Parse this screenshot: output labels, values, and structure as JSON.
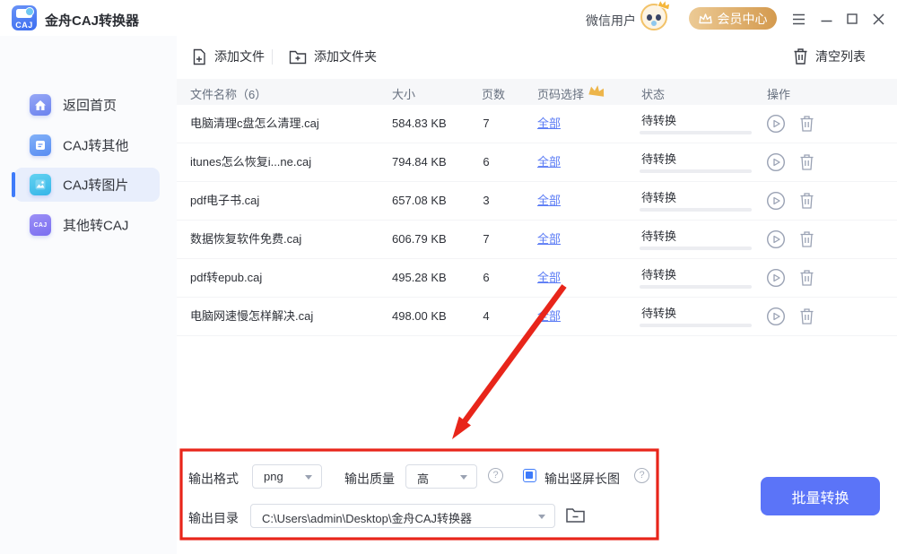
{
  "titlebar": {
    "app_title": "金舟CAJ转换器",
    "logo_text": "CAJ",
    "user_name": "微信用户",
    "member_center": "会员中心"
  },
  "sidebar": {
    "items": [
      {
        "label": "返回首页",
        "icon": "home-icon",
        "active": false
      },
      {
        "label": "CAJ转其他",
        "icon": "document-icon",
        "active": false
      },
      {
        "label": "CAJ转图片",
        "icon": "image-icon",
        "active": true
      },
      {
        "label": "其他转CAJ",
        "icon": "caj-badge-icon",
        "active": false
      }
    ],
    "caj_badge_text": "CAJ"
  },
  "toolbar": {
    "add_file": "添加文件",
    "add_folder": "添加文件夹",
    "clear_list": "清空列表"
  },
  "table": {
    "headers": {
      "name": "文件名称（6）",
      "size": "大小",
      "pages": "页数",
      "page_select": "页码选择",
      "status": "状态",
      "action": "操作"
    },
    "rows": [
      {
        "name": "电脑清理c盘怎么清理.caj",
        "size": "584.83 KB",
        "pages": "7",
        "page_select": "全部",
        "status": "待转换"
      },
      {
        "name": "itunes怎么恢复i...ne.caj",
        "size": "794.84 KB",
        "pages": "6",
        "page_select": "全部",
        "status": "待转换"
      },
      {
        "name": "pdf电子书.caj",
        "size": "657.08 KB",
        "pages": "3",
        "page_select": "全部",
        "status": "待转换"
      },
      {
        "name": "数据恢复软件免费.caj",
        "size": "606.79 KB",
        "pages": "7",
        "page_select": "全部",
        "status": "待转换"
      },
      {
        "name": "pdf转epub.caj",
        "size": "495.28 KB",
        "pages": "6",
        "page_select": "全部",
        "status": "待转换"
      },
      {
        "name": "电脑网速慢怎样解决.caj",
        "size": "498.00 KB",
        "pages": "4",
        "page_select": "全部",
        "status": "待转换"
      }
    ]
  },
  "settings": {
    "output_format_label": "输出格式",
    "output_format_value": "png",
    "output_quality_label": "输出质量",
    "output_quality_value": "高",
    "vertical_long_image_label": "输出竖屏长图",
    "vertical_long_image_checked": true,
    "output_dir_label": "输出目录",
    "output_dir_value": "C:\\Users\\admin\\Desktop\\金舟CAJ转换器"
  },
  "actions": {
    "batch_convert": "批量转换"
  },
  "colors": {
    "accent_blue": "#3e7bfa",
    "batch_button_blue": "#5b74f8",
    "link_blue": "#5a7bf5",
    "member_gold": "#d49a4e",
    "annotation_red": "#e8251a",
    "sidebar_selected_bg": "#e8eefc",
    "table_header_bg": "#f6f7f9"
  }
}
